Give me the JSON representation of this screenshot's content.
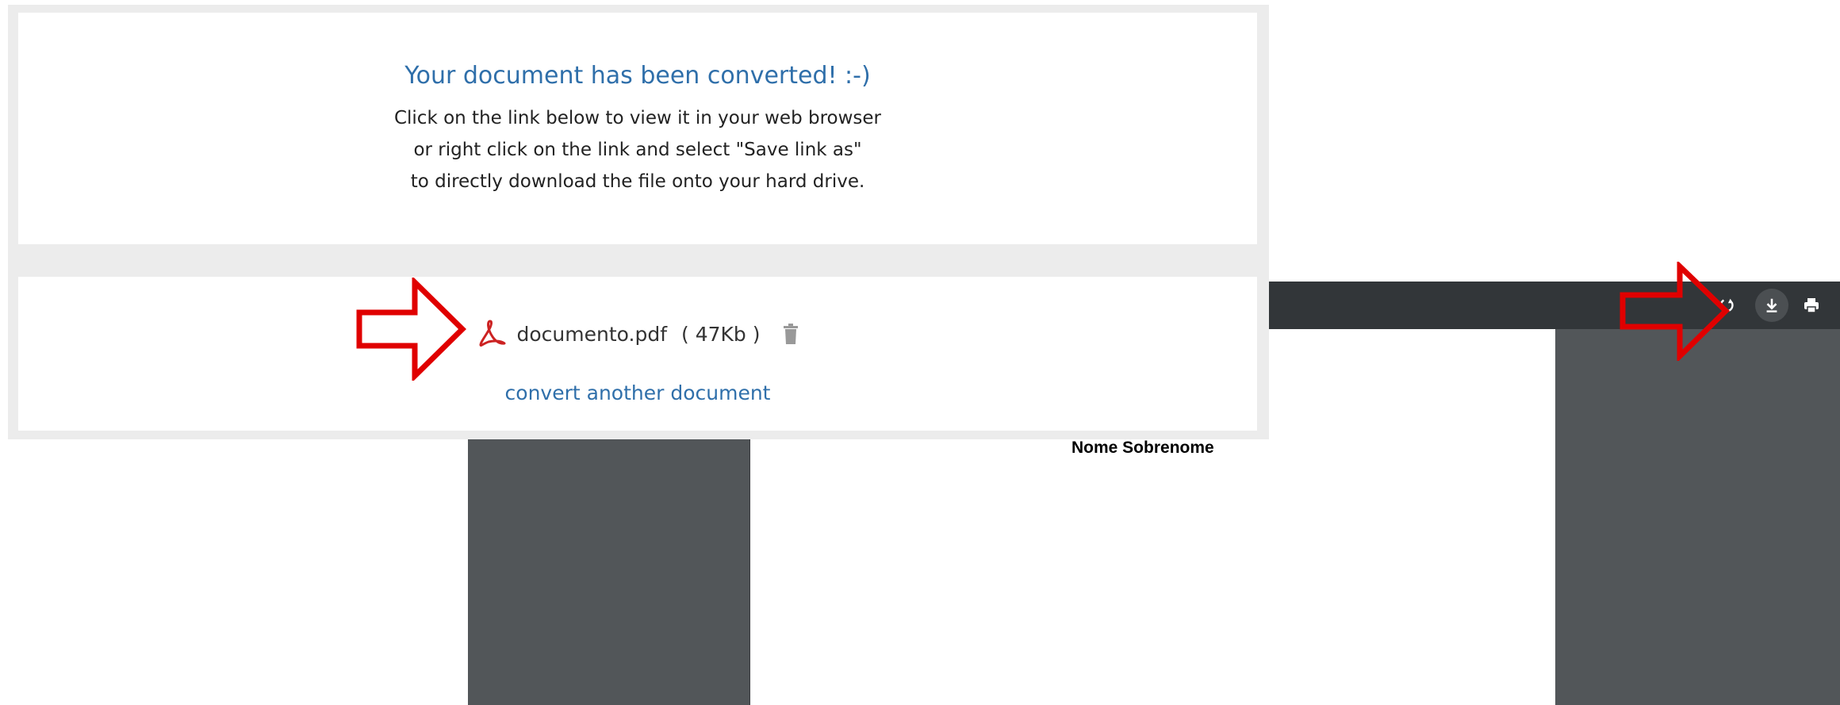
{
  "converter": {
    "title": "Your document has been converted! :-)",
    "instructions": [
      "Click on the link below to view it in your web browser",
      "or right click on the link and select \"Save link as\"",
      "to directly download the file onto your hard drive."
    ],
    "file": {
      "name": "documento.pdf",
      "size": "( 47Kb )",
      "icon": "pdf-icon"
    },
    "convert_another_label": "convert another document"
  },
  "viewer": {
    "page_text": "Nome Sobrenome",
    "toolbar_icons": [
      "rotate-icon",
      "download-icon",
      "print-icon"
    ]
  },
  "colors": {
    "link": "#2f6faa",
    "pdf_red": "#cc2222",
    "arrow_red": "#e00000",
    "viewer_toolbar": "#323639",
    "viewer_canvas": "#525659"
  }
}
